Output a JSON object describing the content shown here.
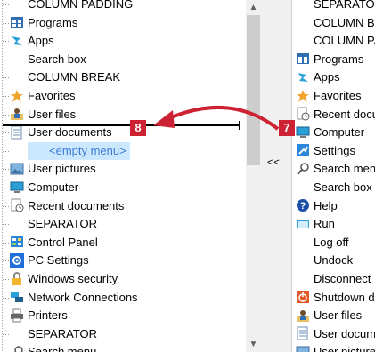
{
  "left_tree": [
    {
      "label": "COLUMN PADDING",
      "icon": "none"
    },
    {
      "label": "Programs",
      "icon": "programs-icon"
    },
    {
      "label": "Apps",
      "icon": "apps-icon"
    },
    {
      "label": "Search box",
      "icon": "none"
    },
    {
      "label": "COLUMN BREAK",
      "icon": "none"
    },
    {
      "label": "Favorites",
      "icon": "favorites-icon"
    },
    {
      "label": "User files",
      "icon": "user-files-icon"
    },
    {
      "label": "User documents",
      "icon": "user-documents-icon"
    },
    {
      "label": "<empty menu>",
      "icon": "none"
    },
    {
      "label": "User pictures",
      "icon": "user-pictures-icon"
    },
    {
      "label": "Computer",
      "icon": "computer-icon"
    },
    {
      "label": "Recent documents",
      "icon": "recent-documents-icon"
    },
    {
      "label": "SEPARATOR",
      "icon": "none"
    },
    {
      "label": "Control Panel",
      "icon": "control-panel-icon"
    },
    {
      "label": "PC Settings",
      "icon": "pc-settings-icon"
    },
    {
      "label": "Windows security",
      "icon": "windows-security-icon"
    },
    {
      "label": "Network Connections",
      "icon": "network-icon"
    },
    {
      "label": "Printers",
      "icon": "printers-icon"
    },
    {
      "label": "SEPARATOR",
      "icon": "none"
    },
    {
      "label": "Search menu",
      "icon": "search-menu-icon"
    }
  ],
  "right_list": [
    {
      "label": "SEPARATOR",
      "icon": "none"
    },
    {
      "label": "COLUMN BREAK",
      "icon": "none"
    },
    {
      "label": "COLUMN PADDING",
      "icon": "none"
    },
    {
      "label": "Programs",
      "icon": "programs-icon"
    },
    {
      "label": "Apps",
      "icon": "apps-icon"
    },
    {
      "label": "Favorites",
      "icon": "favorites-icon"
    },
    {
      "label": "Recent documents",
      "icon": "recent-documents-icon"
    },
    {
      "label": "Computer",
      "icon": "computer-icon"
    },
    {
      "label": "Settings",
      "icon": "settings-icon"
    },
    {
      "label": "Search menu",
      "icon": "search-menu-icon"
    },
    {
      "label": "Search box",
      "icon": "none"
    },
    {
      "label": "Help",
      "icon": "help-icon"
    },
    {
      "label": "Run",
      "icon": "run-icon"
    },
    {
      "label": "Log off",
      "icon": "none"
    },
    {
      "label": "Undock",
      "icon": "none"
    },
    {
      "label": "Disconnect",
      "icon": "none"
    },
    {
      "label": "Shutdown dialog",
      "icon": "shutdown-icon"
    },
    {
      "label": "User files",
      "icon": "user-files-icon"
    },
    {
      "label": "User documents",
      "icon": "user-documents-icon"
    },
    {
      "label": "User pictures",
      "icon": "user-pictures-icon"
    }
  ],
  "move_left_button": "<<",
  "badges": {
    "left": "8",
    "right": "7"
  },
  "colors": {
    "accent_red": "#cc2233",
    "selection": "#cce8ff"
  }
}
